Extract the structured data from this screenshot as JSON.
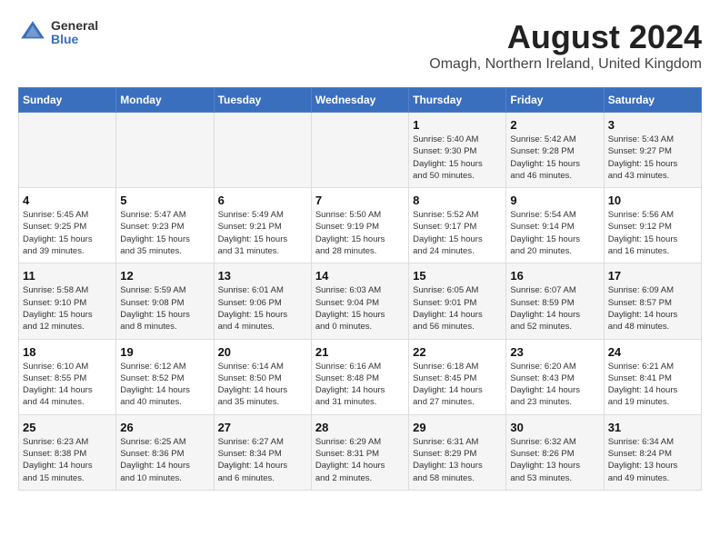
{
  "header": {
    "logo_general": "General",
    "logo_blue": "Blue",
    "month_year": "August 2024",
    "location": "Omagh, Northern Ireland, United Kingdom"
  },
  "weekdays": [
    "Sunday",
    "Monday",
    "Tuesday",
    "Wednesday",
    "Thursday",
    "Friday",
    "Saturday"
  ],
  "weeks": [
    [
      {
        "day": "",
        "info": ""
      },
      {
        "day": "",
        "info": ""
      },
      {
        "day": "",
        "info": ""
      },
      {
        "day": "",
        "info": ""
      },
      {
        "day": "1",
        "info": "Sunrise: 5:40 AM\nSunset: 9:30 PM\nDaylight: 15 hours\nand 50 minutes."
      },
      {
        "day": "2",
        "info": "Sunrise: 5:42 AM\nSunset: 9:28 PM\nDaylight: 15 hours\nand 46 minutes."
      },
      {
        "day": "3",
        "info": "Sunrise: 5:43 AM\nSunset: 9:27 PM\nDaylight: 15 hours\nand 43 minutes."
      }
    ],
    [
      {
        "day": "4",
        "info": "Sunrise: 5:45 AM\nSunset: 9:25 PM\nDaylight: 15 hours\nand 39 minutes."
      },
      {
        "day": "5",
        "info": "Sunrise: 5:47 AM\nSunset: 9:23 PM\nDaylight: 15 hours\nand 35 minutes."
      },
      {
        "day": "6",
        "info": "Sunrise: 5:49 AM\nSunset: 9:21 PM\nDaylight: 15 hours\nand 31 minutes."
      },
      {
        "day": "7",
        "info": "Sunrise: 5:50 AM\nSunset: 9:19 PM\nDaylight: 15 hours\nand 28 minutes."
      },
      {
        "day": "8",
        "info": "Sunrise: 5:52 AM\nSunset: 9:17 PM\nDaylight: 15 hours\nand 24 minutes."
      },
      {
        "day": "9",
        "info": "Sunrise: 5:54 AM\nSunset: 9:14 PM\nDaylight: 15 hours\nand 20 minutes."
      },
      {
        "day": "10",
        "info": "Sunrise: 5:56 AM\nSunset: 9:12 PM\nDaylight: 15 hours\nand 16 minutes."
      }
    ],
    [
      {
        "day": "11",
        "info": "Sunrise: 5:58 AM\nSunset: 9:10 PM\nDaylight: 15 hours\nand 12 minutes."
      },
      {
        "day": "12",
        "info": "Sunrise: 5:59 AM\nSunset: 9:08 PM\nDaylight: 15 hours\nand 8 minutes."
      },
      {
        "day": "13",
        "info": "Sunrise: 6:01 AM\nSunset: 9:06 PM\nDaylight: 15 hours\nand 4 minutes."
      },
      {
        "day": "14",
        "info": "Sunrise: 6:03 AM\nSunset: 9:04 PM\nDaylight: 15 hours\nand 0 minutes."
      },
      {
        "day": "15",
        "info": "Sunrise: 6:05 AM\nSunset: 9:01 PM\nDaylight: 14 hours\nand 56 minutes."
      },
      {
        "day": "16",
        "info": "Sunrise: 6:07 AM\nSunset: 8:59 PM\nDaylight: 14 hours\nand 52 minutes."
      },
      {
        "day": "17",
        "info": "Sunrise: 6:09 AM\nSunset: 8:57 PM\nDaylight: 14 hours\nand 48 minutes."
      }
    ],
    [
      {
        "day": "18",
        "info": "Sunrise: 6:10 AM\nSunset: 8:55 PM\nDaylight: 14 hours\nand 44 minutes."
      },
      {
        "day": "19",
        "info": "Sunrise: 6:12 AM\nSunset: 8:52 PM\nDaylight: 14 hours\nand 40 minutes."
      },
      {
        "day": "20",
        "info": "Sunrise: 6:14 AM\nSunset: 8:50 PM\nDaylight: 14 hours\nand 35 minutes."
      },
      {
        "day": "21",
        "info": "Sunrise: 6:16 AM\nSunset: 8:48 PM\nDaylight: 14 hours\nand 31 minutes."
      },
      {
        "day": "22",
        "info": "Sunrise: 6:18 AM\nSunset: 8:45 PM\nDaylight: 14 hours\nand 27 minutes."
      },
      {
        "day": "23",
        "info": "Sunrise: 6:20 AM\nSunset: 8:43 PM\nDaylight: 14 hours\nand 23 minutes."
      },
      {
        "day": "24",
        "info": "Sunrise: 6:21 AM\nSunset: 8:41 PM\nDaylight: 14 hours\nand 19 minutes."
      }
    ],
    [
      {
        "day": "25",
        "info": "Sunrise: 6:23 AM\nSunset: 8:38 PM\nDaylight: 14 hours\nand 15 minutes."
      },
      {
        "day": "26",
        "info": "Sunrise: 6:25 AM\nSunset: 8:36 PM\nDaylight: 14 hours\nand 10 minutes."
      },
      {
        "day": "27",
        "info": "Sunrise: 6:27 AM\nSunset: 8:34 PM\nDaylight: 14 hours\nand 6 minutes."
      },
      {
        "day": "28",
        "info": "Sunrise: 6:29 AM\nSunset: 8:31 PM\nDaylight: 14 hours\nand 2 minutes."
      },
      {
        "day": "29",
        "info": "Sunrise: 6:31 AM\nSunset: 8:29 PM\nDaylight: 13 hours\nand 58 minutes."
      },
      {
        "day": "30",
        "info": "Sunrise: 6:32 AM\nSunset: 8:26 PM\nDaylight: 13 hours\nand 53 minutes."
      },
      {
        "day": "31",
        "info": "Sunrise: 6:34 AM\nSunset: 8:24 PM\nDaylight: 13 hours\nand 49 minutes."
      }
    ]
  ]
}
